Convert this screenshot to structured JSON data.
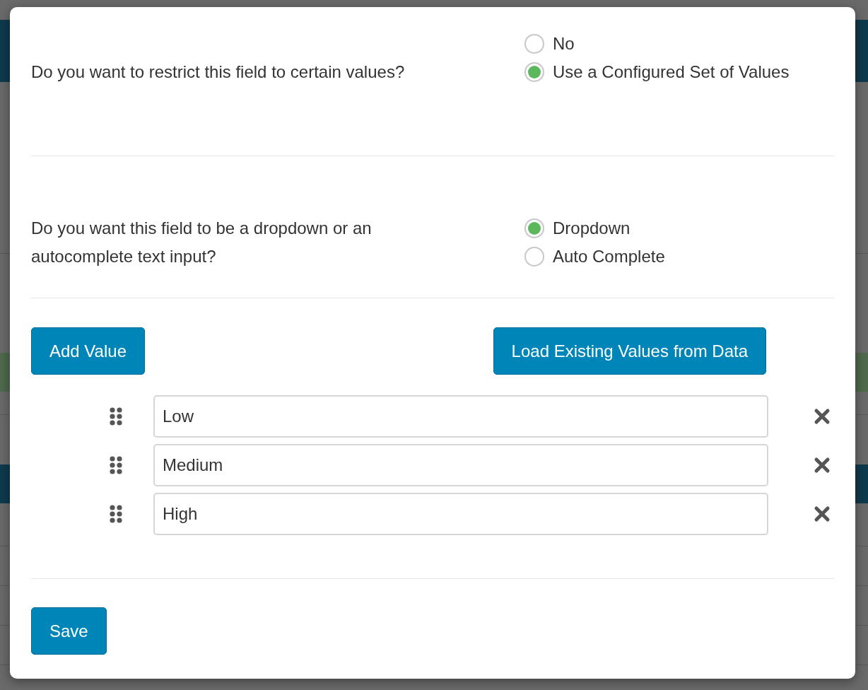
{
  "questions": [
    {
      "text": "Do you want to restrict this field to certain values?",
      "options": [
        {
          "label": "No",
          "selected": false
        },
        {
          "label": "Use a Configured Set of Values",
          "selected": true
        }
      ]
    },
    {
      "text": "Do you want this field to be a dropdown or an autocomplete text input?",
      "options": [
        {
          "label": "Dropdown",
          "selected": true
        },
        {
          "label": "Auto Complete",
          "selected": false
        }
      ]
    }
  ],
  "add_button": "Add Value",
  "load_button": "Load Existing Values from Data",
  "values": [
    {
      "value": "Low"
    },
    {
      "value": "Medium"
    },
    {
      "value": "High"
    }
  ],
  "save_button": "Save"
}
